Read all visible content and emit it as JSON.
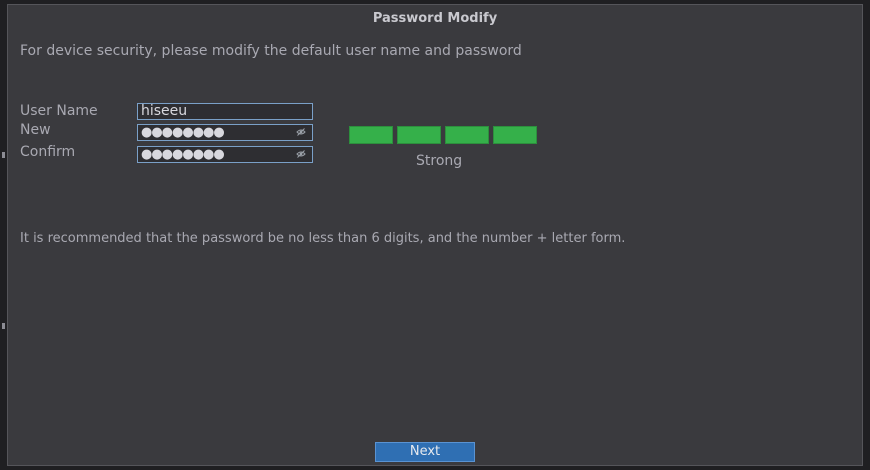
{
  "dialog": {
    "title": "Password Modify",
    "intro": "For device security, please modify the default user name and password",
    "labels": {
      "user_name": "User Name",
      "new": "New",
      "confirm": "Confirm"
    },
    "fields": {
      "user_name_value": "hiseeu",
      "new_password_value": "●●●●●●●●",
      "confirm_password_value": "●●●●●●●●"
    },
    "strength": {
      "filled_segments": 4,
      "total_segments": 4,
      "label": "Strong",
      "color": "#35b04a"
    },
    "hint": "It is recommended that the password be no less than 6 digits, and the number + letter form.",
    "next_label": "Next"
  },
  "theme": {
    "dialog_bg": "#3a3a3e",
    "accent": "#2f6fb3",
    "text": "#a9a9b2"
  },
  "icons": {
    "eye": "eye-icon"
  }
}
